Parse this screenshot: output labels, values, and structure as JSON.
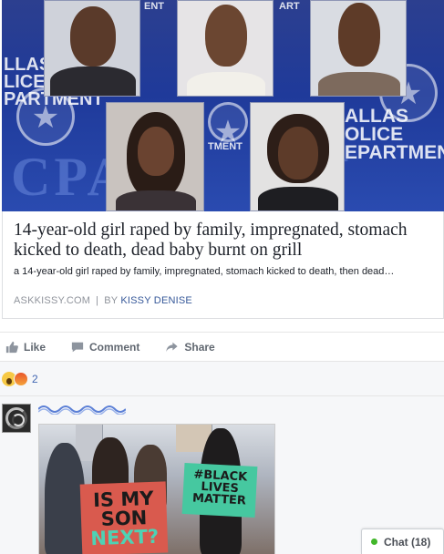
{
  "link_preview": {
    "headline": "14-year-old girl raped by family, impregnated, stomach kicked to death, dead baby burnt on grill",
    "description": "a 14-year-old girl raped by family, impregnated, stomach kicked to death, then dead…",
    "source": "ASKKISSY.COM",
    "separator": "|",
    "by_label": "BY",
    "author": "KISSY DENISE",
    "image_text": {
      "left_banner": "LLAS\nLICE\nPARTMENT",
      "right_banner": "ALLAS\nOLICE\nEPARTMENT",
      "top_fragment_1": "ENT",
      "top_fragment_2": "ART",
      "middle_fragment": "TMENT"
    }
  },
  "actions": {
    "like": "Like",
    "comment": "Comment",
    "share": "Share"
  },
  "reactions": {
    "icons": [
      "wow-icon",
      "angry-icon"
    ],
    "count": "2"
  },
  "comment_photo": {
    "sign_red_line1": "IS MY",
    "sign_red_line2": "SON",
    "sign_red_line3": "NEXT?",
    "sign_green": "#BLACK LIVES MATTER"
  },
  "chat": {
    "label": "Chat (18)",
    "status_color": "#42b72a"
  },
  "colors": {
    "link": "#365899",
    "muted": "#90949c",
    "action": "#606770",
    "background": "#f6f7f9"
  }
}
